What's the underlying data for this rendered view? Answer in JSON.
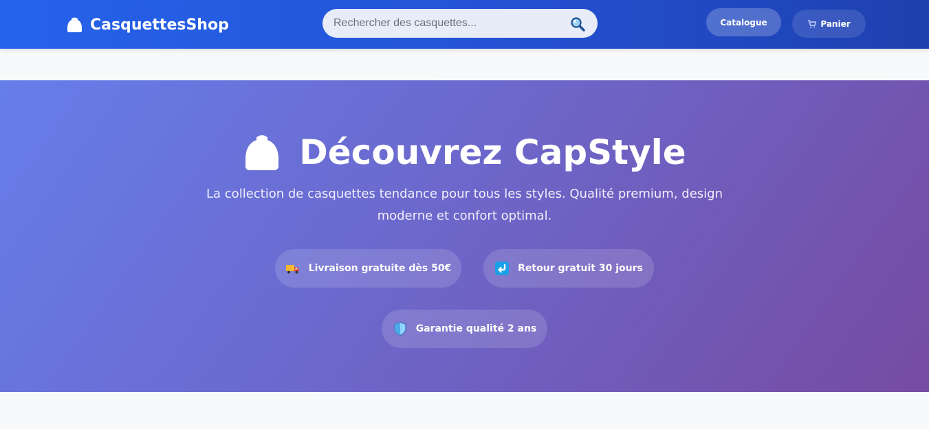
{
  "header": {
    "brand": "CasquettesShop",
    "search": {
      "placeholder": "Rechercher des casquettes...",
      "value": ""
    },
    "nav": {
      "catalogue_label": "Catalogue",
      "panier_label": "Panier"
    }
  },
  "hero": {
    "title": "Découvrez CapStyle",
    "subtitle": "La collection de casquettes tendance pour tous les styles. Qualité premium, design moderne et confort optimal.",
    "features": [
      {
        "icon": "truck-icon",
        "label": "Livraison gratuite dès 50€"
      },
      {
        "icon": "return-arrow-icon",
        "label": "Retour gratuit 30 jours"
      },
      {
        "icon": "shield-icon",
        "label": "Garantie qualité 2 ans"
      }
    ]
  },
  "colors": {
    "header_gradient": [
      "#2563eb",
      "#1e40af"
    ],
    "hero_gradient": [
      "#667eea",
      "#764ba2"
    ]
  }
}
